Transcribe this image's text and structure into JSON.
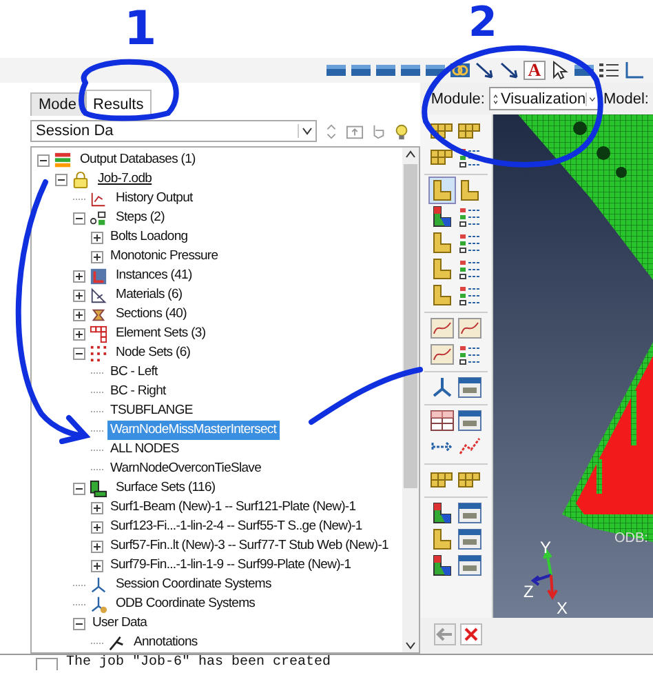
{
  "annotations": [
    {
      "label": "1"
    },
    {
      "label": "2"
    }
  ],
  "toolbar": {
    "text_tool": "A"
  },
  "tabs": [
    {
      "label": "Mode",
      "selected": false
    },
    {
      "label": "Results",
      "selected": true
    }
  ],
  "session_combo": {
    "value": "Session Da"
  },
  "tree": [
    {
      "label": "Output Databases (1)",
      "kind": "database",
      "expanded": true,
      "selected": false,
      "children": [
        {
          "label": "Job-7.odb",
          "kind": "odb",
          "expanded": true,
          "selected": false,
          "children": [
            {
              "label": "History Output",
              "kind": "history",
              "selected": false
            },
            {
              "label": "Steps (2)",
              "kind": "steps",
              "expanded": true,
              "selected": false,
              "children": [
                {
                  "label": "Bolts Loadong",
                  "kind": "plain",
                  "expanded": false,
                  "selected": false
                },
                {
                  "label": "Monotonic Pressure",
                  "kind": "plain",
                  "expanded": false,
                  "selected": false
                }
              ]
            },
            {
              "label": "Instances (41)",
              "kind": "instances",
              "expanded": false,
              "selected": false
            },
            {
              "label": "Materials (6)",
              "kind": "materials",
              "expanded": false,
              "selected": false
            },
            {
              "label": "Sections (40)",
              "kind": "sections",
              "expanded": false,
              "selected": false
            },
            {
              "label": "Element Sets (3)",
              "kind": "elements",
              "expanded": false,
              "selected": false
            },
            {
              "label": "Node Sets (6)",
              "kind": "nodes",
              "expanded": true,
              "selected": false,
              "children": [
                {
                  "label": "BC - Left",
                  "kind": "plain",
                  "selected": false
                },
                {
                  "label": "BC - Right",
                  "kind": "plain",
                  "selected": false
                },
                {
                  "label": "TSUBFLANGE",
                  "kind": "plain",
                  "selected": false
                },
                {
                  "label": "WarnNodeMissMasterIntersect",
                  "kind": "plain",
                  "selected": true
                },
                {
                  "label": "ALL NODES",
                  "kind": "plain",
                  "selected": false
                },
                {
                  "label": "WarnNodeOverconTieSlave",
                  "kind": "plain",
                  "selected": false
                }
              ]
            },
            {
              "label": "Surface Sets (116)",
              "kind": "surfaces",
              "expanded": true,
              "selected": false,
              "children": [
                {
                  "label": "Surf1-Beam (New)-1 -- Surf121-Plate (New)-1",
                  "kind": "plain",
                  "expanded": false,
                  "selected": false
                },
                {
                  "label": "Surf123-Fi...-1-lin-2-4 -- Surf55-T S..ge (New)-1",
                  "kind": "plain",
                  "expanded": false,
                  "selected": false
                },
                {
                  "label": "Surf57-Fin..lt (New)-3 -- Surf77-T Stub Web (New)-1",
                  "kind": "plain",
                  "expanded": false,
                  "selected": false
                },
                {
                  "label": "Surf79-Fin...-1-lin-1-9 -- Surf99-Plate (New)-1",
                  "kind": "plain",
                  "expanded": false,
                  "selected": false
                }
              ]
            },
            {
              "label": "Session Coordinate Systems",
              "kind": "csys",
              "selected": false
            },
            {
              "label": "ODB Coordinate Systems",
              "kind": "odbcsys",
              "selected": false
            },
            {
              "label": "User Data",
              "kind": "plain",
              "expanded": true,
              "selected": false,
              "children": [
                {
                  "label": "Annotations",
                  "kind": "annotation",
                  "selected": false
                }
              ]
            }
          ]
        }
      ]
    }
  ],
  "module_bar": {
    "module_label": "Module:",
    "module_value": "Visualization",
    "model_label": "Model:"
  },
  "viewport": {
    "triad": [
      {
        "label": "Y",
        "kind": "y"
      },
      {
        "label": "Z",
        "kind": "z"
      },
      {
        "label": "X",
        "kind": "x"
      }
    ],
    "odb_label": "ODB:"
  },
  "message": "The job \"Job-6\" has been created"
}
